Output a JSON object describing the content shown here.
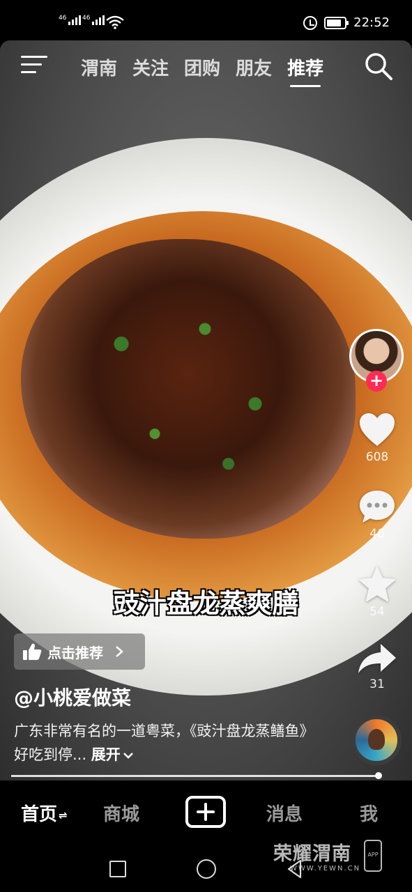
{
  "status_bar": {
    "signal_1": "46",
    "signal_2": "46",
    "time": "22:52"
  },
  "top_nav": {
    "tabs": [
      {
        "label": "渭南"
      },
      {
        "label": "关注"
      },
      {
        "label": "团购"
      },
      {
        "label": "朋友"
      },
      {
        "label": "推荐"
      }
    ],
    "active_tab": "推荐"
  },
  "video": {
    "caption": "豉汁盘龙蒸爽膳"
  },
  "right_rail": {
    "like_count": "608",
    "comment_count": "46",
    "favorite_count": "54",
    "share_count": "31"
  },
  "info": {
    "recommend_label": "点击推荐",
    "author": "@小桃爱做菜",
    "description": "广东非常有名的一道粤菜，《豉汁盘龙蒸鳝鱼》好吃到停...",
    "expand_label": "展开"
  },
  "bottom_tabs": {
    "home": "首页",
    "mall": "商城",
    "messages": "消息",
    "me": "我"
  },
  "watermark": {
    "title": "荣耀渭南",
    "url": "WWW.YEWN.CN",
    "app_label": "APP"
  },
  "colors": {
    "follow_accent": "#fe2c55",
    "background": "#000000"
  }
}
